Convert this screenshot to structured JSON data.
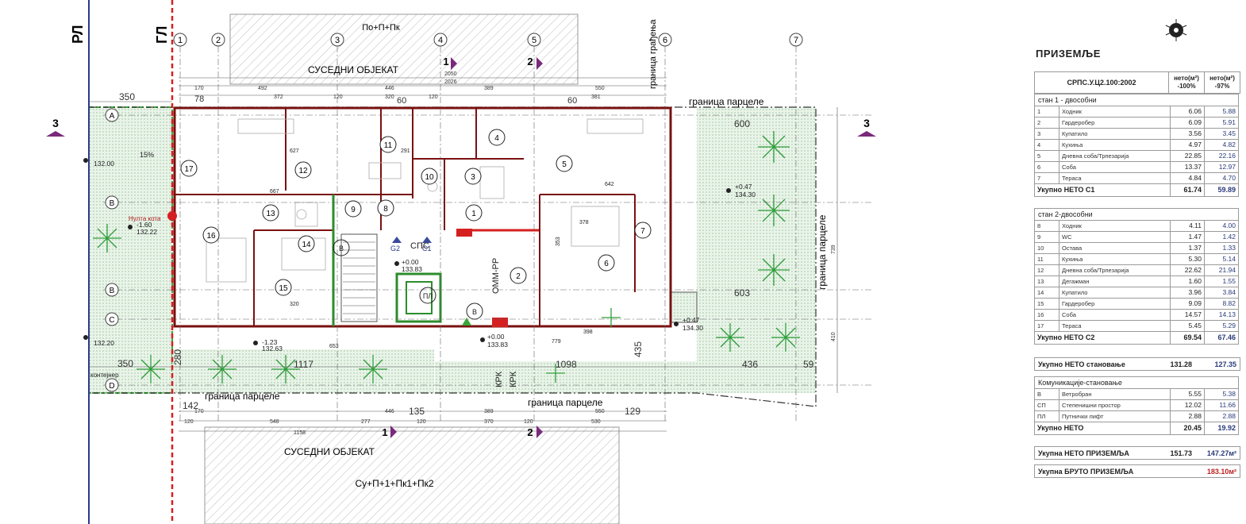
{
  "plan": {
    "axes_top": [
      "1",
      "2",
      "3",
      "4",
      "5",
      "6",
      "7"
    ],
    "axes_left": [
      "A",
      "B",
      "B",
      "C",
      "D"
    ],
    "rl_label": "РЛ",
    "gl_label": "ГЛ",
    "neighbor_top_label": "По+П+Пк",
    "neighbor_top_title": "СУСЕДНИ ОБЈЕКАТ",
    "neighbor_bottom_title": "СУСЕДНИ ОБЈЕКАТ",
    "neighbor_bottom_label": "Су+П+1+Пк1+Пк2",
    "boundary_top": "граница парцеле",
    "boundary_bottom_left": "граница парцеле",
    "boundary_bottom_right": "граница парцеле",
    "boundary_right": "граница парцеле",
    "boundary_rotated": "граница грађења",
    "section_marks": [
      "3",
      "3",
      "1",
      "2",
      "1",
      "2"
    ],
    "dims_top": [
      "2050",
      "2026",
      "492",
      "446",
      "389",
      "550",
      "170",
      "372",
      "120",
      "320",
      "120",
      "381",
      "60",
      "60",
      "78"
    ],
    "dims_bottom": [
      "1158",
      "548",
      "277",
      "446",
      "389",
      "550",
      "170",
      "120",
      "120",
      "370",
      "530",
      "120",
      "142",
      "135",
      "129"
    ],
    "dim_350_top": "350",
    "dim_350_bottom": "350",
    "dim_280": "280",
    "dim_1117": "1117",
    "dim_1098": "1098",
    "dim_436": "436",
    "dim_59": "59",
    "dim_600": "600",
    "dim_603": "603",
    "dim_435": "435",
    "dim_739": "739",
    "dim_410": "410",
    "levels": [
      "132.00",
      "132.20",
      "+0.47",
      "134.30",
      "+0.47",
      "134.30",
      "-1.60",
      "132.22",
      "-1.23",
      "132.63",
      "+0.00",
      "133.83",
      "+0.00",
      "133.83"
    ],
    "rooms": [
      "1",
      "2",
      "3",
      "4",
      "5",
      "6",
      "7",
      "8",
      "9",
      "10",
      "11",
      "12",
      "13",
      "14",
      "15",
      "16",
      "17"
    ],
    "labels_misc": {
      "spc": "СПС",
      "g2": "G2",
      "c1": "C1",
      "pl": "ПЛ",
      "b1": "B",
      "b2": "B",
      "omm": "ОММ-РР",
      "krk": "КРК",
      "kontejner": "контејнер",
      "slope": "15%",
      "kota": "Нулта кота",
      "rm1": "627",
      "rm2": "667",
      "rm3": "642",
      "rm4": "291",
      "rm5": "320",
      "rm6": "378",
      "rm7": "353",
      "rm8": "779",
      "rm9": "398",
      "rm10": "653"
    }
  },
  "panel": {
    "title": "ПРИЗЕМЉЕ",
    "header_code": "СРПС.У.Ц2.100:2002",
    "header_col1": "нето(м²) -100%",
    "header_col2": "нето(м²) -97%",
    "group1_title": "стан 1 - двособни",
    "group1_rows": [
      {
        "n": "1",
        "name": "Ходник",
        "a": "6.06",
        "b": "5.88"
      },
      {
        "n": "2",
        "name": "Гардеробер",
        "a": "6.09",
        "b": "5.91"
      },
      {
        "n": "3",
        "name": "Купатило",
        "a": "3.56",
        "b": "3.45"
      },
      {
        "n": "4",
        "name": "Кухиња",
        "a": "4.97",
        "b": "4.82"
      },
      {
        "n": "5",
        "name": "Дневна соба/Трпезарија",
        "a": "22.85",
        "b": "22.16"
      },
      {
        "n": "6",
        "name": "Соба",
        "a": "13.37",
        "b": "12.97"
      },
      {
        "n": "7",
        "name": "Тераса",
        "a": "4.84",
        "b": "4.70"
      }
    ],
    "group1_total": {
      "label": "Укупно НЕТО С1",
      "a": "61.74",
      "b": "59.89"
    },
    "group2_title": "стан 2-двособни",
    "group2_rows": [
      {
        "n": "8",
        "name": "Ходник",
        "a": "4.11",
        "b": "4.00"
      },
      {
        "n": "9",
        "name": "WC",
        "a": "1.47",
        "b": "1.42"
      },
      {
        "n": "10",
        "name": "Остава",
        "a": "1.37",
        "b": "1.33"
      },
      {
        "n": "11",
        "name": "Кухиња",
        "a": "5.30",
        "b": "5.14"
      },
      {
        "n": "12",
        "name": "Дневна соба/Трпезарија",
        "a": "22.62",
        "b": "21.94"
      },
      {
        "n": "13",
        "name": "Дегажман",
        "a": "1.60",
        "b": "1.55"
      },
      {
        "n": "14",
        "name": "Купатило",
        "a": "3.96",
        "b": "3.84"
      },
      {
        "n": "15",
        "name": "Гардеробер",
        "a": "9.09",
        "b": "8.82"
      },
      {
        "n": "16",
        "name": "Соба",
        "a": "14.57",
        "b": "14.13"
      },
      {
        "n": "17",
        "name": "Тераса",
        "a": "5.45",
        "b": "5.29"
      }
    ],
    "group2_total": {
      "label": "Укупно НЕТО С2",
      "a": "69.54",
      "b": "67.46"
    },
    "housing_total": {
      "label": "Укупно НЕТО становање",
      "a": "131.28",
      "b": "127.35"
    },
    "group3_title": "Комуникације-становање",
    "group3_rows": [
      {
        "n": "В",
        "name": "Ветробран",
        "a": "5.55",
        "b": "5.38"
      },
      {
        "n": "СП",
        "name": "Степенишни простор",
        "a": "12.02",
        "b": "11.66"
      },
      {
        "n": "ПЛ",
        "name": "Путнички лифт",
        "a": "2.88",
        "b": "2.88"
      }
    ],
    "group3_total": {
      "label": "Укупно НЕТО",
      "a": "20.45",
      "b": "19.92"
    },
    "ground_net": {
      "label": "Укупна НЕТО ПРИЗЕМЉА",
      "a": "151.73",
      "b": "147.27м²"
    },
    "ground_gross": {
      "label": "Укупна БРУТО ПРИЗЕМЉА",
      "b": "183.10м²"
    }
  },
  "colors": {
    "accent_red": "#d42020",
    "axis_blue": "#2a3a7a",
    "green": "#3aa63a",
    "wall": "#7a1010"
  }
}
